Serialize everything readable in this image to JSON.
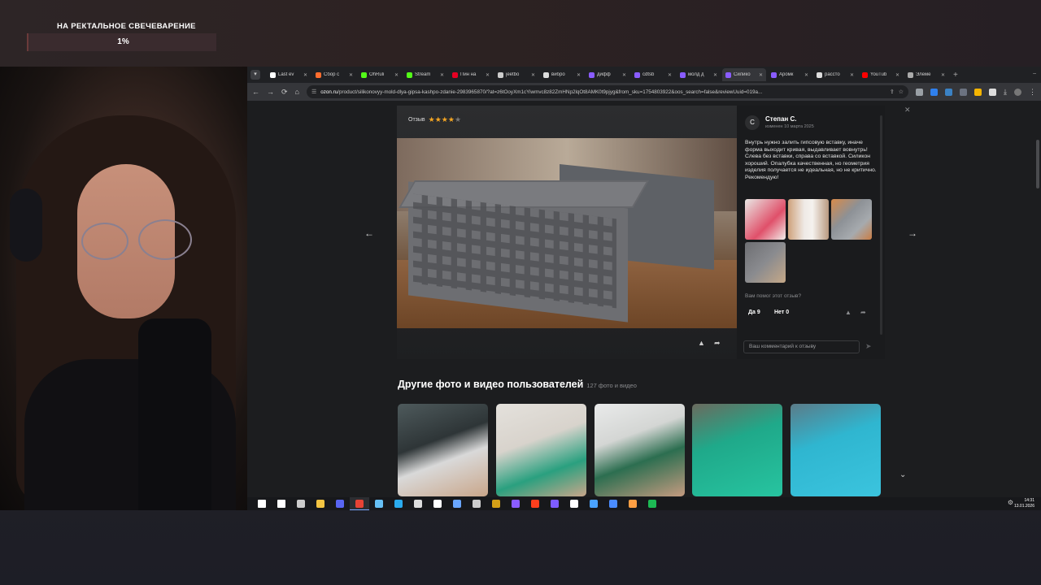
{
  "overlay": {
    "title": "НА РЕКТАЛЬНОЕ СВЕЧЕВАРЕНИЕ",
    "progress_text": "1%",
    "progress": 0.01
  },
  "browser": {
    "tabs": [
      {
        "label": "Last ev",
        "fav_color": "#ffffff",
        "active": false
      },
      {
        "label": "Сбор с",
        "fav_color": "#ff6d2e",
        "active": false
      },
      {
        "label": "OhRuli",
        "fav_color": "#53fc18",
        "active": false
      },
      {
        "label": "Stream",
        "fav_color": "#53fc18",
        "active": false
      },
      {
        "label": "Пин на",
        "fav_color": "#e60023",
        "active": false
      },
      {
        "label": "jeetbo",
        "fav_color": "#cccccc",
        "active": false
      },
      {
        "label": "вибро",
        "fav_color": "#dddddd",
        "active": false
      },
      {
        "label": "дифф",
        "fav_color": "#8a5cff",
        "active": false
      },
      {
        "label": "cdtsb",
        "fav_color": "#8a5cff",
        "active": false
      },
      {
        "label": "молд д",
        "fav_color": "#8a5cff",
        "active": false
      },
      {
        "label": "Силико",
        "fav_color": "#8a5cff",
        "active": true
      },
      {
        "label": "Аромк",
        "fav_color": "#8a5cff",
        "active": false
      },
      {
        "label": "рассто",
        "fav_color": "#dddddd",
        "active": false
      },
      {
        "label": "YouTub",
        "fav_color": "#ff0000",
        "active": false
      },
      {
        "label": "Элеме",
        "fav_color": "#aaaaaa",
        "active": false
      }
    ],
    "url_domain": "ozon.ru",
    "url_path": "/product/silikonovyy-mold-dlya-gipsa-kashpo-zdanie-2983965870/?at=z6tOoyXm1cYiwmvc8z82ZmHNp2lqOt8AMK0t9pjyg&from_sku=1754803922&oos_search=false&reviewUuid=019a..."
  },
  "review": {
    "badge_label": "Отзыв",
    "rating": 4,
    "rating_max": 5,
    "author_initial": "С",
    "author": "Степан С.",
    "edited": "изменен 10 марта 2025",
    "text": "Внутрь нужно залить гипсовую вставку, иначе форма выходит кривая, выдавливает вовнутрь! Слева без вставки, справа со вставкой. Силикон хороший. Опалубка качественная, но геометрия изделия получается не идеальная, но не критично. Рекомендую!",
    "helpful_question": "Вам помог этот отзыв?",
    "yes_label": "Да 9",
    "no_label": "Нет 0",
    "comment_placeholder": "Ваш комментарий к отзыву"
  },
  "gallery": {
    "title": "Другие фото и видео пользователей",
    "count": "127 фото и видео"
  },
  "taskbar": {
    "time": "14:31",
    "date": "13.01.2026",
    "apps": [
      {
        "name": "windows-start-icon",
        "color": "#ffffff"
      },
      {
        "name": "search-icon",
        "color": "#ffffff"
      },
      {
        "name": "task-view-icon",
        "color": "#cccccc"
      },
      {
        "name": "file-explorer-icon",
        "color": "#f4c542"
      },
      {
        "name": "discord-icon",
        "color": "#5865f2"
      },
      {
        "name": "chrome-icon",
        "color": "#e84335"
      },
      {
        "name": "steam-icon",
        "color": "#66c0f4"
      },
      {
        "name": "telegram-icon",
        "color": "#2aabee"
      },
      {
        "name": "obs-icon",
        "color": "#dddddd"
      },
      {
        "name": "document-icon",
        "color": "#ffffff"
      },
      {
        "name": "lc-icon",
        "color": "#6aa7ff"
      },
      {
        "name": "app-icon",
        "color": "#cccccc"
      },
      {
        "name": "app-icon-2",
        "color": "#d4a017"
      },
      {
        "name": "t-app-icon",
        "color": "#8a5cff"
      },
      {
        "name": "yandex-icon",
        "color": "#fc3f1d"
      },
      {
        "name": "app-icon-3",
        "color": "#7d5cff"
      },
      {
        "name": "notes-icon",
        "color": "#ffffff"
      },
      {
        "name": "c-app-icon",
        "color": "#4aa3ff"
      },
      {
        "name": "signal-icon",
        "color": "#4a8cff"
      },
      {
        "name": "app-icon-4",
        "color": "#ff9f43"
      },
      {
        "name": "spotify-icon",
        "color": "#1db954"
      }
    ]
  }
}
